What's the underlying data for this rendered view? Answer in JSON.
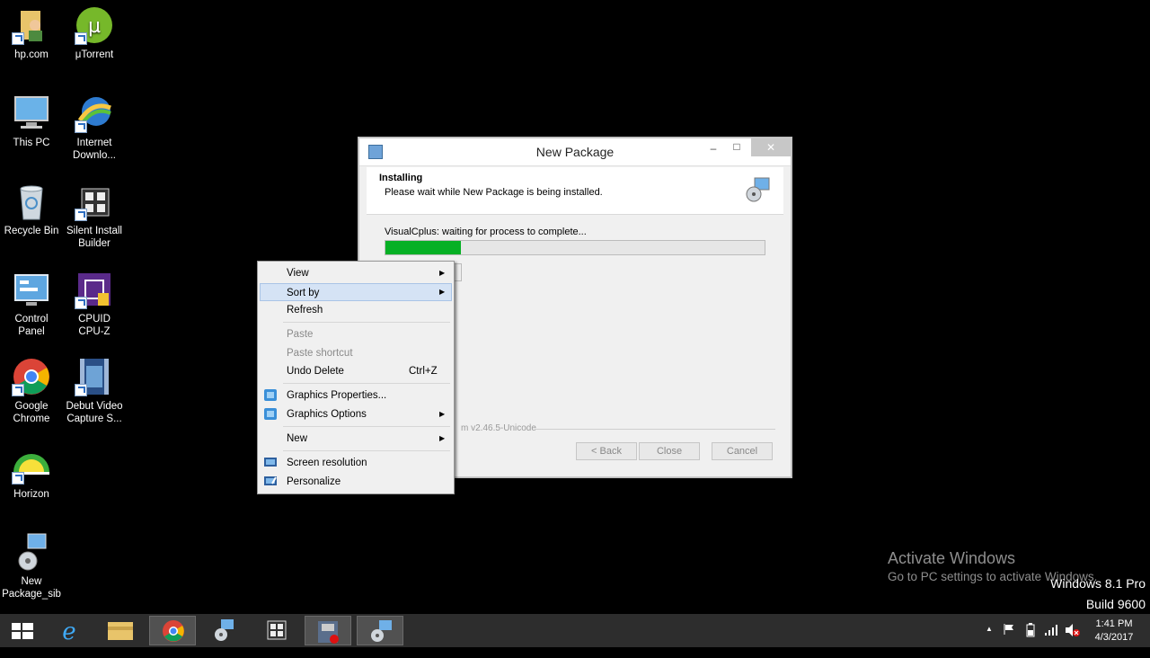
{
  "desktop": {
    "icons": [
      {
        "label": "hp.com",
        "icon": "folder-user-icon"
      },
      {
        "label": "μTorrent",
        "icon": "utorrent-icon"
      },
      {
        "label": "This PC",
        "icon": "computer-icon"
      },
      {
        "label": "Internet\nDownlo...",
        "icon": "idm-icon"
      },
      {
        "label": "Recycle Bin",
        "icon": "recycle-bin-icon"
      },
      {
        "label": "Silent Install\nBuilder",
        "icon": "silent-install-icon"
      },
      {
        "label": "Control\nPanel",
        "icon": "control-panel-icon"
      },
      {
        "label": "CPUID\nCPU-Z",
        "icon": "cpuz-icon"
      },
      {
        "label": "Google\nChrome",
        "icon": "chrome-icon"
      },
      {
        "label": "Debut Video\nCapture S...",
        "icon": "debut-icon"
      },
      {
        "label": "Horizon",
        "icon": "horizon-icon"
      },
      {
        "label": "New\nPackage_sib",
        "icon": "package-icon"
      }
    ]
  },
  "installer": {
    "title": "New Package",
    "header_title": "Installing",
    "header_subtitle": "Please wait while New Package is being installed.",
    "status": "VisualCplus: waiting for process to complete...",
    "progress": 0.2,
    "branding": "m v2.46.5-Unicode",
    "buttons": {
      "back": "< Back",
      "close": "Close",
      "cancel": "Cancel"
    },
    "window_controls": {
      "minimize": "–",
      "maximize": "□",
      "close": "✕"
    }
  },
  "context_menu": {
    "items": [
      {
        "label": "View",
        "submenu": true
      },
      {
        "label": "Sort by",
        "submenu": true,
        "highlighted": true
      },
      {
        "label": "Refresh"
      },
      {
        "label": "Paste",
        "disabled": true
      },
      {
        "label": "Paste shortcut",
        "disabled": true
      },
      {
        "label": "Undo Delete",
        "shortcut": "Ctrl+Z"
      },
      {
        "label": "Graphics Properties..."
      },
      {
        "label": "Graphics Options",
        "submenu": true
      },
      {
        "label": "New",
        "submenu": true
      },
      {
        "label": "Screen resolution"
      },
      {
        "label": "Personalize"
      }
    ],
    "arrow": "▶"
  },
  "watermark": {
    "line1": "Activate Windows",
    "line2": "Go to PC settings to activate Windows."
  },
  "edition": {
    "line1": "Windows 8.1 Pro",
    "line2": "Build 9600"
  },
  "taskbar": {
    "tray_expand": "▲",
    "clock_time": "1:41 PM",
    "clock_date": "4/3/2017"
  }
}
